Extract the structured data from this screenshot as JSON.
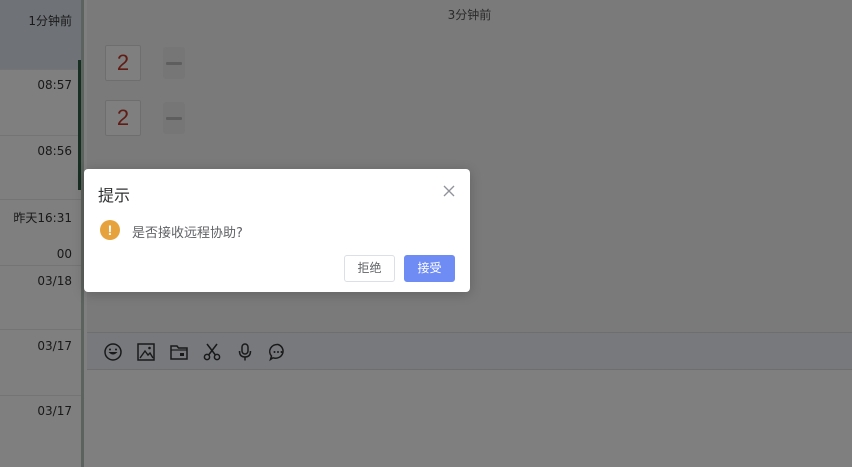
{
  "sidebar": {
    "items": [
      {
        "time": "1分钟前"
      },
      {
        "time": "08:57"
      },
      {
        "time": "08:56"
      },
      {
        "time": "昨天16:31"
      },
      {
        "time": "00"
      },
      {
        "time": "03/18"
      },
      {
        "time": "03/17"
      },
      {
        "time": "03/17"
      }
    ]
  },
  "chat": {
    "timestamp": "3分钟前",
    "messages": [
      {
        "avatar_text": "2"
      },
      {
        "avatar_text": "2"
      }
    ]
  },
  "toolbar": {
    "tools": [
      "emoji-icon",
      "image-icon",
      "folder-icon",
      "scissors-icon",
      "microphone-icon",
      "chat-bubble-icon"
    ]
  },
  "dialog": {
    "title": "提示",
    "message": "是否接收远程协助?",
    "warn_symbol": "!",
    "reject_label": "拒绝",
    "accept_label": "接受"
  },
  "colors": {
    "accent": "#6f8cf5",
    "warning": "#e6a23c",
    "avatar_text": "#c0392b"
  }
}
